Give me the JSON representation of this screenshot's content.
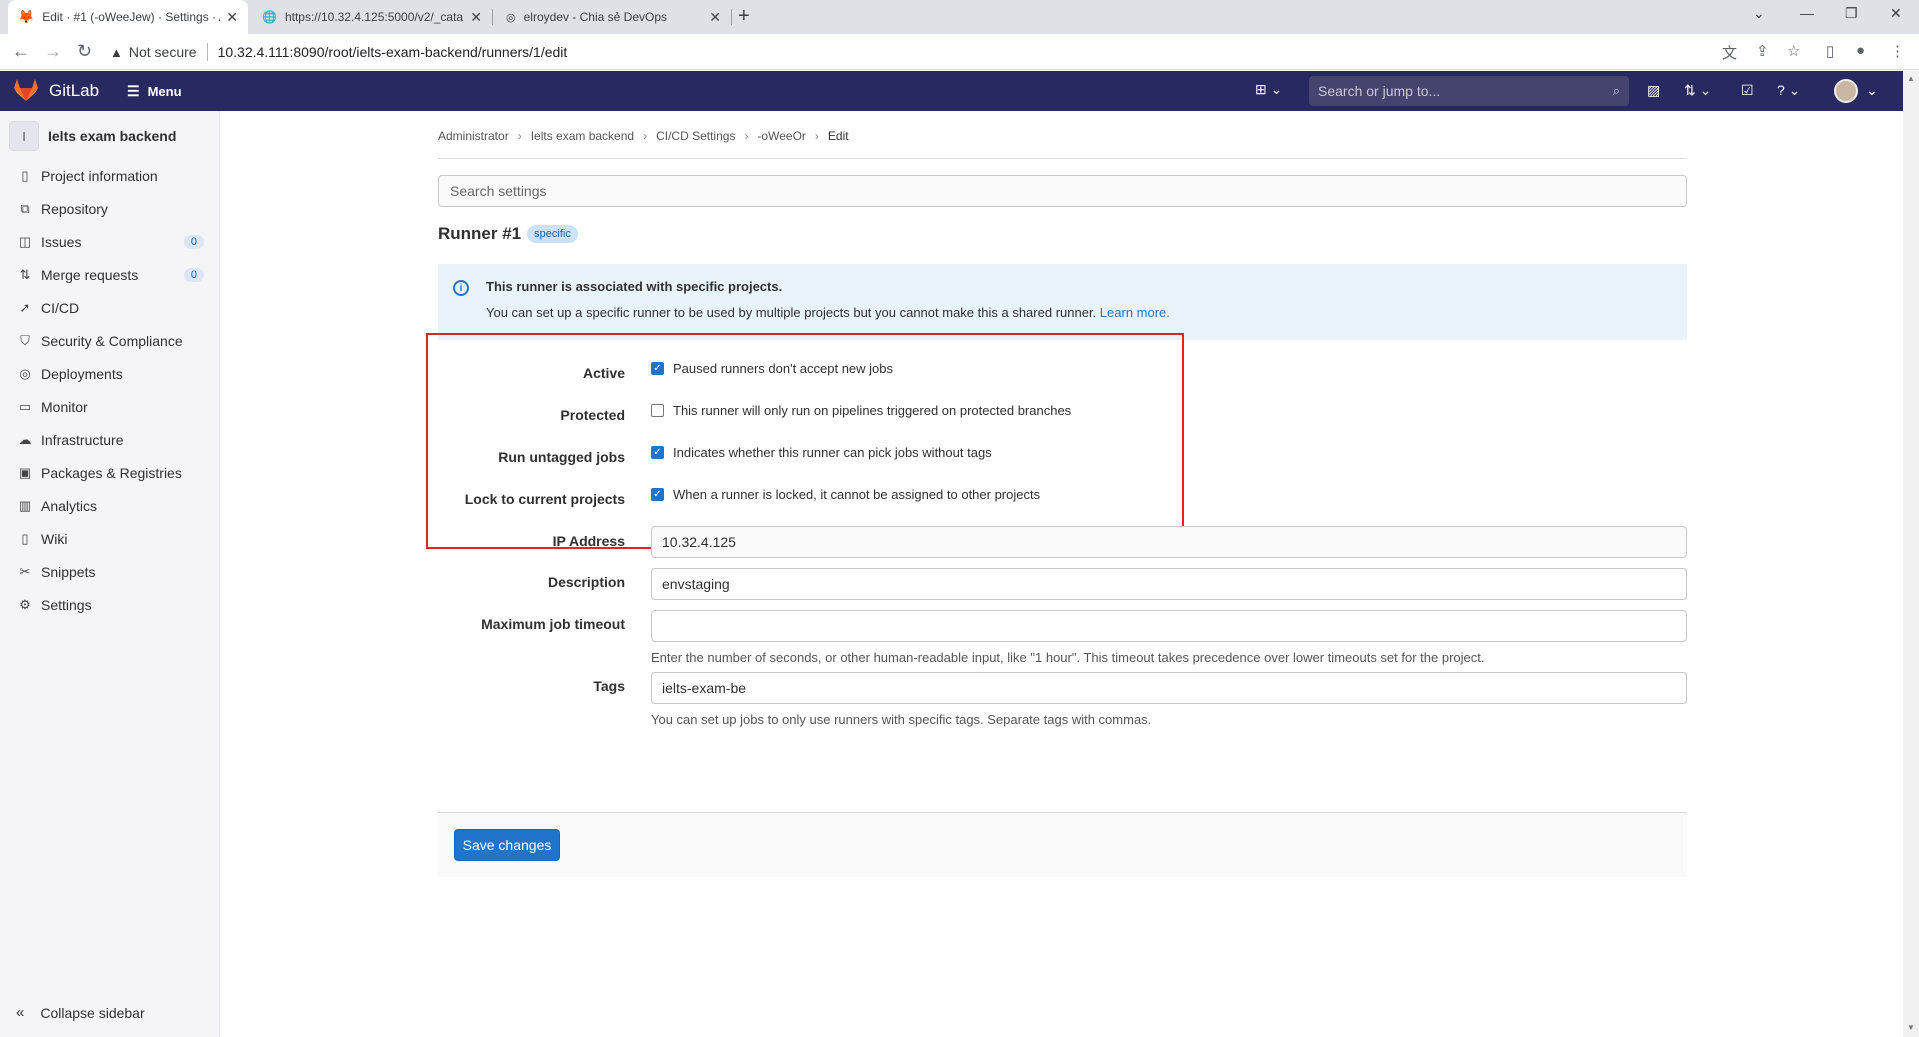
{
  "browser": {
    "tabs": [
      {
        "title": "Edit · #1 (-oWeeJew) · Settings · A",
        "active": true
      },
      {
        "title": "https://10.32.4.125:5000/v2/_cata",
        "active": false
      },
      {
        "title": "elroydev - Chia sẻ DevOps",
        "active": false
      }
    ],
    "security_label": "Not secure",
    "url": "10.32.4.111:8090/root/ielts-exam-backend/runners/1/edit"
  },
  "header": {
    "brand": "GitLab",
    "menu_label": "Menu",
    "search_placeholder": "Search or jump to..."
  },
  "sidebar": {
    "project_initial": "I",
    "project_name": "Ielts exam backend",
    "items": [
      {
        "label": "Project information",
        "icon": "info-icon"
      },
      {
        "label": "Repository",
        "icon": "repository-icon"
      },
      {
        "label": "Issues",
        "icon": "issues-icon",
        "count": "0"
      },
      {
        "label": "Merge requests",
        "icon": "merge-request-icon",
        "count": "0"
      },
      {
        "label": "CI/CD",
        "icon": "rocket-icon"
      },
      {
        "label": "Security & Compliance",
        "icon": "shield-icon"
      },
      {
        "label": "Deployments",
        "icon": "deployments-icon"
      },
      {
        "label": "Monitor",
        "icon": "monitor-icon"
      },
      {
        "label": "Infrastructure",
        "icon": "cloud-icon"
      },
      {
        "label": "Packages & Registries",
        "icon": "package-icon"
      },
      {
        "label": "Analytics",
        "icon": "chart-icon"
      },
      {
        "label": "Wiki",
        "icon": "book-icon"
      },
      {
        "label": "Snippets",
        "icon": "scissors-icon"
      },
      {
        "label": "Settings",
        "icon": "gear-icon"
      }
    ],
    "collapse_label": "Collapse sidebar"
  },
  "breadcrumb": [
    "Administrator",
    "Ielts exam backend",
    "CI/CD Settings",
    "-oWeeOr",
    "Edit"
  ],
  "search_settings_placeholder": "Search settings",
  "runner": {
    "title": "Runner #1",
    "badge": "specific"
  },
  "alert": {
    "title": "This runner is associated with specific projects.",
    "body": "You can set up a specific runner to be used by multiple projects but you cannot make this a shared runner.",
    "link": "Learn more."
  },
  "form": {
    "active": {
      "label": "Active",
      "text": "Paused runners don't accept new jobs",
      "checked": true
    },
    "protected": {
      "label": "Protected",
      "text": "This runner will only run on pipelines triggered on protected branches",
      "checked": false
    },
    "untagged": {
      "label": "Run untagged jobs",
      "text": "Indicates whether this runner can pick jobs without tags",
      "checked": true
    },
    "locked": {
      "label": "Lock to current projects",
      "text": "When a runner is locked, it cannot be assigned to other projects",
      "checked": true
    },
    "ip": {
      "label": "IP Address",
      "value": "10.32.4.125"
    },
    "description": {
      "label": "Description",
      "value": "envstaging"
    },
    "timeout": {
      "label": "Maximum job timeout",
      "value": "",
      "help": "Enter the number of seconds, or other human-readable input, like \"1 hour\". This timeout takes precedence over lower timeouts set for the project."
    },
    "tags": {
      "label": "Tags",
      "value": "ielts-exam-be",
      "help": "You can set up jobs to only use runners with specific tags. Separate tags with commas."
    },
    "save_label": "Save changes"
  },
  "colors": {
    "header_bg": "#292961",
    "accent": "#1f75cb",
    "highlight": "#e0242a"
  }
}
